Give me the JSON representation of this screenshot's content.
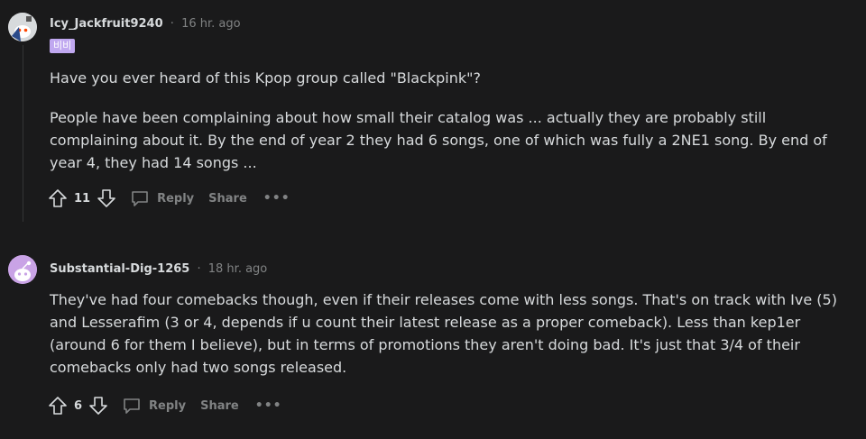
{
  "comments": [
    {
      "username": "Icy_Jackfruit9240",
      "separator": "·",
      "time": "16 hr. ago",
      "flair": "비비",
      "paragraphs": [
        "Have you ever heard of this Kpop group called \"Blackpink\"?",
        "People have been complaining about how small their catalog was ... actually they are probably still complaining about it. By the end of year 2 they had 6 songs, one of which was fully a 2NE1 song. By end of year 4, they had 14 songs ..."
      ],
      "score": "11",
      "reply_label": "Reply",
      "share_label": "Share",
      "more_label": "•••"
    },
    {
      "username": "Substantial-Dig-1265",
      "separator": "·",
      "time": "18 hr. ago",
      "paragraphs": [
        "They've had four comebacks though, even if their releases come with less songs. That's on track with Ive (5) and Lesserafim (3 or 4, depends if u count their latest release as a proper comeback). Less than kep1er (around 6 for them I believe), but in terms of promotions they aren't doing bad. It's just that 3/4 of their comebacks only had two songs released."
      ],
      "score": "6",
      "reply_label": "Reply",
      "share_label": "Share",
      "more_label": "•••"
    }
  ],
  "icons": {
    "upvote": "upvote-arrow-icon",
    "downvote": "downvote-arrow-icon",
    "reply": "speech-bubble-icon",
    "avatar1": "snoo-avatar-icon",
    "avatar2": "snoo-avatar-icon"
  },
  "colors": {
    "background": "#1a1a1b",
    "text": "#d7dadc",
    "muted": "#818384",
    "flair": "#c0a8f0",
    "avatar2_bg": "#c9a3e6"
  }
}
